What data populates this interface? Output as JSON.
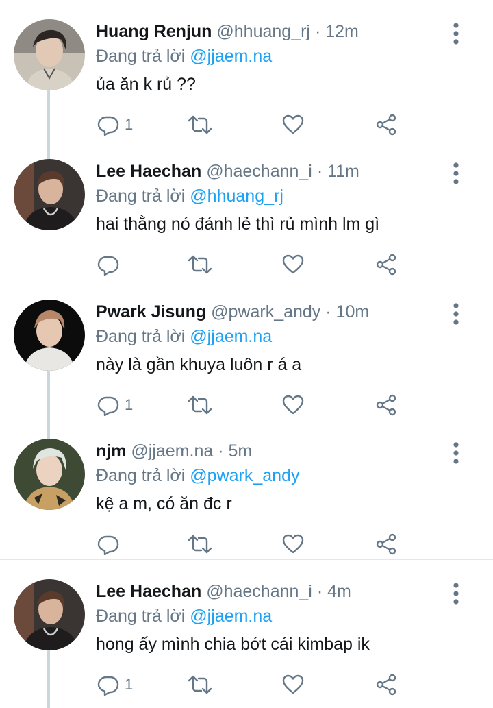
{
  "reply_prefix": "Đang trả lời",
  "colors": {
    "link": "#1da1f2",
    "secondary": "#657786",
    "primary": "#14171a",
    "divider": "#e1e8ed",
    "thread": "#ccd6dd"
  },
  "icons": {
    "reply": "reply-icon",
    "retweet": "retweet-icon",
    "like": "heart-icon",
    "share": "share-icon",
    "more": "more-vertical-icon"
  },
  "tweets": [
    {
      "name": "Huang Renjun",
      "handle": "@hhuang_rj",
      "dot": "·",
      "time": "12m",
      "reply_to": "@jjaem.na",
      "text": "ủa ăn k rủ ??",
      "reply_count": "1"
    },
    {
      "name": "Lee Haechan",
      "handle": "@haechann_i",
      "dot": "·",
      "time": "11m",
      "reply_to": "@hhuang_rj",
      "text": "hai thằng nó đánh lẻ thì rủ mình lm gì",
      "reply_count": ""
    },
    {
      "name": "Pwark Jisung",
      "handle": "@pwark_andy",
      "dot": "·",
      "time": "10m",
      "reply_to": "@jjaem.na",
      "text": "này là gần khuya luôn r á a",
      "reply_count": "1"
    },
    {
      "name": "njm",
      "handle": "@jjaem.na",
      "dot": "·",
      "time": "5m",
      "reply_to": "@pwark_andy",
      "text": "kệ a m, có ăn đc r",
      "reply_count": ""
    },
    {
      "name": "Lee Haechan",
      "handle": "@haechann_i",
      "dot": "·",
      "time": "4m",
      "reply_to": "@jjaem.na",
      "text": "hong ấy mình chia bớt cái kimbap ik",
      "reply_count": "1"
    }
  ]
}
